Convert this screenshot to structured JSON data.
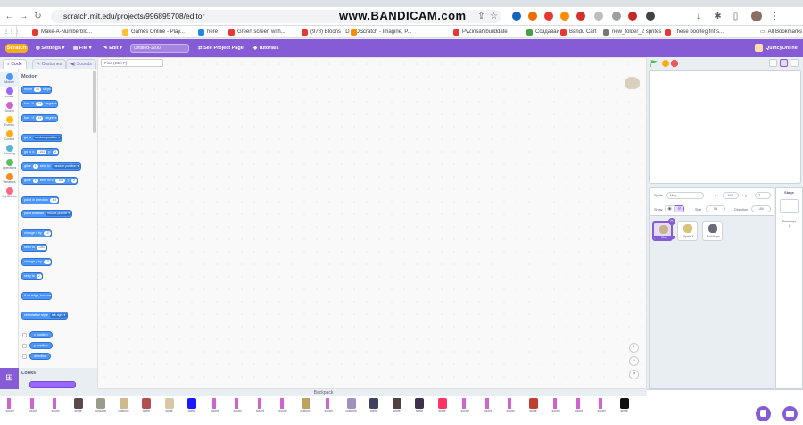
{
  "browser": {
    "url": "scratch.mit.edu/projects/996895708/editor",
    "watermark": "www.BANDICAM.com",
    "bookmarks": [
      {
        "label": "Make-A-Numberblo...",
        "color": "#e53935"
      },
      {
        "label": "Games Online - Play...",
        "color": "#fbc02d"
      },
      {
        "label": "here",
        "color": "#1e88e5"
      },
      {
        "label": "Green screen with...",
        "color": "#e53935"
      },
      {
        "label": "(978) Bloons TD 5 O...",
        "color": "#e53935"
      },
      {
        "label": "Scratch - Imagine, P...",
        "color": "#fb8c00"
      },
      {
        "label": "PvZinsanibuilddate",
        "color": "#e53935"
      },
      {
        "label": "Создавай",
        "color": "#43a047"
      },
      {
        "label": "Bandu Cart",
        "color": "#e53935"
      },
      {
        "label": "new_folder_2 sprites",
        "color": "#757575"
      },
      {
        "label": "These bootleg fnf s...",
        "color": "#e53935"
      }
    ],
    "all_bookmarks": "All Bookmarks"
  },
  "menu": {
    "logo": "Scratch",
    "settings": "Settings",
    "file": "File",
    "edit": "Edit",
    "project_title": "Untitled-1200",
    "see_project": "See Project Page",
    "tutorials": "Tutorials",
    "user": "QuincyOnline"
  },
  "tabs": {
    "code": "Code",
    "costumes": "Costumes",
    "sounds": "Sounds"
  },
  "categories": [
    {
      "label": "Motion",
      "color": "#4c97ff"
    },
    {
      "label": "Looks",
      "color": "#9966ff"
    },
    {
      "label": "Sound",
      "color": "#cf63cf"
    },
    {
      "label": "Events",
      "color": "#ffbf00"
    },
    {
      "label": "Control",
      "color": "#ffab19"
    },
    {
      "label": "Sensing",
      "color": "#5cb1d6"
    },
    {
      "label": "Operators",
      "color": "#59c059"
    },
    {
      "label": "Variables",
      "color": "#ff8c1a"
    },
    {
      "label": "My Blocks",
      "color": "#ff6680"
    }
  ],
  "palette": {
    "motion_header": "Motion",
    "looks_header": "Looks",
    "blocks": {
      "move": "move",
      "move_n": "10",
      "steps": "steps",
      "turn": "turn",
      "turn_cw_n": "15",
      "turn_ccw_n": "15",
      "degrees": "degrees",
      "goto": "go to",
      "goto_target": "random position",
      "goto_xy": "go to x:",
      "goto_x": "-161",
      "goto_y_label": "y:",
      "goto_y": "2",
      "glide1": "glide",
      "glide1_n": "1",
      "glide1_mid": "secs to",
      "glide1_target": "random position",
      "glide2": "glide",
      "glide2_n": "1",
      "glide2_mid": "secs to x:",
      "glide2_x": "-161",
      "glide2_y_label": "y:",
      "glide2_y": "2",
      "point_dir": "point in direction",
      "point_dir_n": "-84",
      "point_towards": "point towards",
      "point_towards_target": "mouse-pointer",
      "change_x": "change x by",
      "change_x_n": "10",
      "set_x": "set x to",
      "set_x_n": "-161",
      "change_y": "change y by",
      "change_y_n": "10",
      "set_y": "set y to",
      "set_y_n": "2",
      "bounce": "if on edge, bounce",
      "rot_style": "set rotation style",
      "rot_style_val": "left-right",
      "rep_x": "x position",
      "rep_y": "y position",
      "rep_dir": "direction"
    }
  },
  "script_area": {
    "find_placeholder": "Find (Ctrl+F)",
    "zoom_in": "+",
    "zoom_out": "−",
    "zoom_reset": "="
  },
  "sprite_info": {
    "sprite_label": "Sprite",
    "sprite_name": "Moy",
    "x_label": "x",
    "x_val": "-161",
    "y_label": "y",
    "y_val": "2",
    "show_label": "Show",
    "size_label": "Size",
    "size_val": "55",
    "direction_label": "Direction",
    "direction_val": "-84"
  },
  "sprites": [
    {
      "name": "Moy",
      "selected": true
    },
    {
      "name": "Sprite2",
      "selected": false
    },
    {
      "name": "Evil Fwen",
      "selected": false
    }
  ],
  "stage_panel": {
    "title": "Stage",
    "backdrops_label": "Backdrops",
    "backdrops_count": "1"
  },
  "backpack": {
    "title": "Backpack",
    "items": [
      {
        "kind": "sound",
        "label": "sound",
        "color": "#cf63cf"
      },
      {
        "kind": "sound",
        "label": "sound",
        "color": "#cf63cf"
      },
      {
        "kind": "sound",
        "label": "sound",
        "color": "#cf63cf"
      },
      {
        "kind": "sprite",
        "label": "sprite",
        "color": "#5a4a4a"
      },
      {
        "kind": "costume",
        "label": "costume",
        "color": "#9b9b8a"
      },
      {
        "kind": "costume",
        "label": "costume",
        "color": "#d0b98a"
      },
      {
        "kind": "sprite",
        "label": "sprite",
        "color": "#b05050"
      },
      {
        "kind": "sprite",
        "label": "sprite",
        "color": "#d8c8a8"
      },
      {
        "kind": "sprite",
        "label": "sprite",
        "color": "#1a1aff"
      },
      {
        "kind": "sound",
        "label": "sound",
        "color": "#cf63cf"
      },
      {
        "kind": "sound",
        "label": "sound",
        "color": "#cf63cf"
      },
      {
        "kind": "sound",
        "label": "sound",
        "color": "#cf63cf"
      },
      {
        "kind": "sound",
        "label": "sound",
        "color": "#cf63cf"
      },
      {
        "kind": "costume",
        "label": "costume",
        "color": "#c0a060"
      },
      {
        "kind": "sound",
        "label": "sound",
        "color": "#cf63cf"
      },
      {
        "kind": "costume",
        "label": "costume",
        "color": "#a090c0"
      },
      {
        "kind": "sprite",
        "label": "sprite",
        "color": "#404060"
      },
      {
        "kind": "sprite",
        "label": "sprite",
        "color": "#504040"
      },
      {
        "kind": "sprite",
        "label": "sprite",
        "color": "#403050"
      },
      {
        "kind": "sprite",
        "label": "sprite",
        "color": "#ff3366"
      },
      {
        "kind": "sound",
        "label": "sound",
        "color": "#cf63cf"
      },
      {
        "kind": "sound",
        "label": "sound",
        "color": "#cf63cf"
      },
      {
        "kind": "sound",
        "label": "sound",
        "color": "#cf63cf"
      },
      {
        "kind": "sprite",
        "label": "sprite",
        "color": "#c04030"
      },
      {
        "kind": "sound",
        "label": "sound",
        "color": "#cf63cf"
      },
      {
        "kind": "sound",
        "label": "sound",
        "color": "#cf63cf"
      },
      {
        "kind": "sound",
        "label": "sound",
        "color": "#cf63cf"
      },
      {
        "kind": "sprite",
        "label": "sprite",
        "color": "#111111"
      }
    ]
  }
}
